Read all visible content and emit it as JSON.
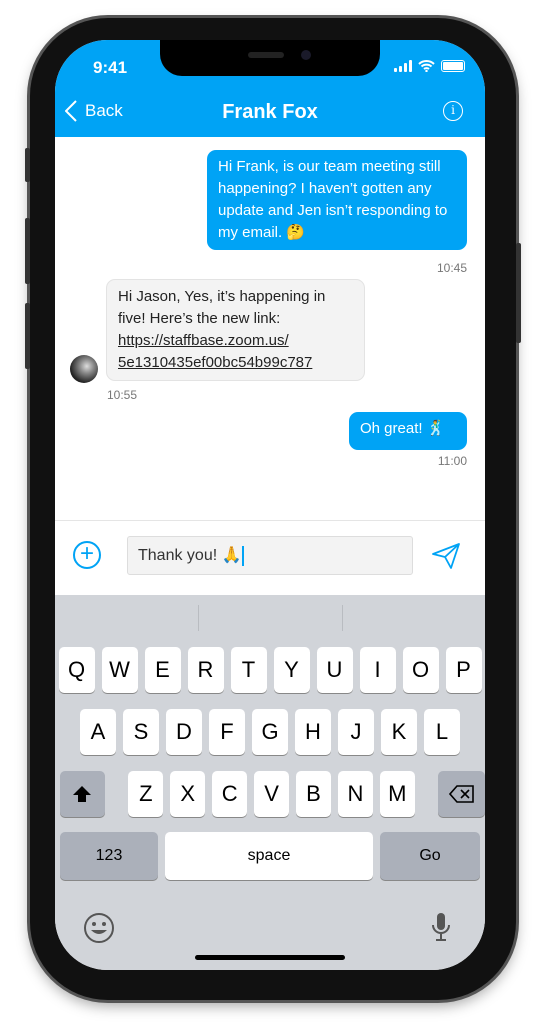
{
  "status_bar": {
    "time": "9:41"
  },
  "header": {
    "back_label": "Back",
    "title": "Frank Fox",
    "info_icon": "info-icon"
  },
  "messages": [
    {
      "direction": "outgoing",
      "text": "Hi Frank, is our team meeting still happening? I haven’t gotten any update and Jen isn’t responding to my email. 🤔",
      "time": "10:45"
    },
    {
      "direction": "incoming",
      "text": "Hi Jason, Yes, it’s happening in five! Here’s the new link:",
      "link": "https://staffbase.zoom.us/ 5e1310435ef00bc54b99c787",
      "time": "10:55"
    },
    {
      "direction": "outgoing",
      "text": "Oh great! 🕺",
      "time": "11:00"
    }
  ],
  "composer": {
    "value": "Thank you! 🙏"
  },
  "keyboard": {
    "row1": [
      "Q",
      "W",
      "E",
      "R",
      "T",
      "Y",
      "U",
      "I",
      "O",
      "P"
    ],
    "row2": [
      "A",
      "S",
      "D",
      "F",
      "G",
      "H",
      "J",
      "K",
      "L"
    ],
    "row3": [
      "Z",
      "X",
      "C",
      "V",
      "B",
      "N",
      "M"
    ],
    "numbers_label": "123",
    "space_label": "space",
    "go_label": "Go"
  },
  "colors": {
    "accent": "#00a3f5",
    "keyboard_bg": "#d1d4d9"
  }
}
